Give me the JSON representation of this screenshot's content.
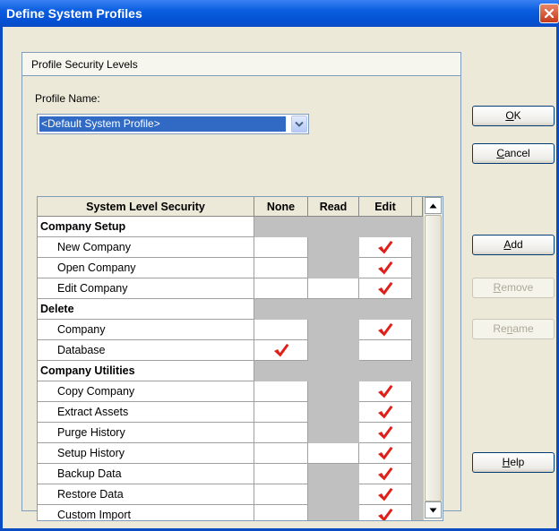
{
  "window": {
    "title": "Define System Profiles"
  },
  "group": {
    "title": "Profile Security Levels",
    "profile_label": "Profile Name:",
    "profile_value": "<Default System Profile>"
  },
  "grid": {
    "headers": {
      "label": "System Level Security",
      "none": "None",
      "read": "Read",
      "edit": "Edit"
    },
    "rows": [
      {
        "type": "section",
        "label": "Company Setup"
      },
      {
        "type": "item",
        "label": "New Company",
        "none": "white",
        "read": "gray",
        "edit": "white",
        "checked": "edit"
      },
      {
        "type": "item",
        "label": "Open Company",
        "none": "white",
        "read": "gray",
        "edit": "white",
        "checked": "edit"
      },
      {
        "type": "item",
        "label": "Edit Company",
        "none": "white",
        "read": "white",
        "edit": "white",
        "checked": "edit"
      },
      {
        "type": "section",
        "label": "Delete"
      },
      {
        "type": "item",
        "label": "Company",
        "none": "white",
        "read": "gray",
        "edit": "white",
        "checked": "edit"
      },
      {
        "type": "item",
        "label": "Database",
        "none": "white",
        "read": "gray",
        "edit": "white",
        "checked": "none"
      },
      {
        "type": "section",
        "label": "Company Utilities"
      },
      {
        "type": "item",
        "label": "Copy Company",
        "none": "white",
        "read": "gray",
        "edit": "white",
        "checked": "edit"
      },
      {
        "type": "item",
        "label": "Extract Assets",
        "none": "white",
        "read": "gray",
        "edit": "white",
        "checked": "edit"
      },
      {
        "type": "item",
        "label": "Purge History",
        "none": "white",
        "read": "gray",
        "edit": "white",
        "checked": "edit"
      },
      {
        "type": "item",
        "label": "Setup History",
        "none": "white",
        "read": "white",
        "edit": "white",
        "checked": "edit"
      },
      {
        "type": "item",
        "label": "Backup Data",
        "none": "white",
        "read": "gray",
        "edit": "white",
        "checked": "edit"
      },
      {
        "type": "item",
        "label": "Restore Data",
        "none": "white",
        "read": "gray",
        "edit": "white",
        "checked": "edit"
      },
      {
        "type": "item",
        "label": "Custom Import",
        "none": "white",
        "read": "gray",
        "edit": "white",
        "checked": "edit"
      }
    ]
  },
  "buttons": {
    "ok": {
      "pre": "",
      "u": "O",
      "post": "K"
    },
    "cancel": {
      "pre": "",
      "u": "C",
      "post": "ancel"
    },
    "add": {
      "pre": "",
      "u": "A",
      "post": "dd"
    },
    "remove": {
      "pre": "",
      "u": "R",
      "post": "emove"
    },
    "rename": {
      "pre": "Re",
      "u": "n",
      "post": "ame"
    },
    "help": {
      "pre": "",
      "u": "H",
      "post": "elp"
    }
  },
  "icons": {
    "close": "close-icon",
    "dropdown": "chevron-down-icon",
    "check": "checkmark-icon",
    "scroll_up": "arrow-up-icon",
    "scroll_down": "arrow-down-icon"
  },
  "colors": {
    "title_bar": "#0a5ee0",
    "selection": "#316ac5",
    "check": "#e0201b",
    "close_button": "#c4391c"
  }
}
